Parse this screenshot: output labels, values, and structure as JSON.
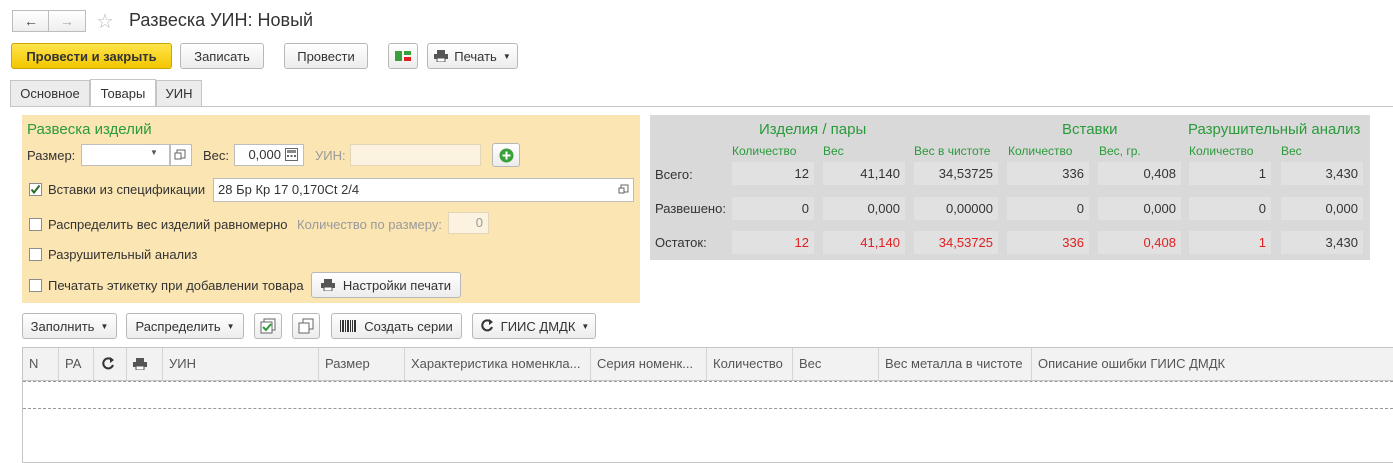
{
  "header": {
    "title": "Развеска УИН: Новый"
  },
  "toolbar": {
    "post_close": "Провести и закрыть",
    "save": "Записать",
    "post": "Провести",
    "print": "Печать"
  },
  "tabs": [
    {
      "label": "Основное"
    },
    {
      "label": "Товары"
    },
    {
      "label": "УИН"
    }
  ],
  "weighing": {
    "title": "Развеска изделий",
    "size_label": "Размер:",
    "size_value": "",
    "weight_label": "Вес:",
    "weight_value": "0,000",
    "uin_label": "УИН:",
    "uin_value": "",
    "spec_checkbox": "Вставки из спецификации",
    "spec_value": "28 Бр Кр 17 0,170Ct 2/4",
    "distribute_checkbox": "Распределить вес изделий равномерно",
    "qty_by_size_label": "Количество по размеру:",
    "qty_by_size_value": "0",
    "destructive_checkbox": "Разрушительный анализ",
    "print_label_checkbox": "Печатать этикетку при добавлении товара",
    "print_settings_button": "Настройки печати"
  },
  "summary": {
    "sections": [
      "Изделия / пары",
      "Вставки",
      "Разрушительный анализ"
    ],
    "columns": [
      "Количество",
      "Вес",
      "Вес в чистоте",
      "Количество",
      "Вес, гр.",
      "Количество",
      "Вес"
    ],
    "rows": [
      {
        "label": "Всего:",
        "values": [
          "12",
          "41,140",
          "34,53725",
          "336",
          "0,408",
          "1",
          "3,430"
        ]
      },
      {
        "label": "Развешено:",
        "values": [
          "0",
          "0,000",
          "0,00000",
          "0",
          "0,000",
          "0",
          "0,000"
        ]
      },
      {
        "label": "Остаток:",
        "values": [
          "12",
          "41,140",
          "34,53725",
          "336",
          "0,408",
          "1",
          "3,430"
        ]
      }
    ]
  },
  "table_toolbar": {
    "fill": "Заполнить",
    "distribute": "Распределить",
    "create_series": "Создать серии",
    "giis": "ГИИС ДМДК"
  },
  "table": {
    "columns": [
      "N",
      "РА",
      "",
      "",
      "УИН",
      "Размер",
      "Характеристика номенкла...",
      "Серия номенк...",
      "Количество",
      "Вес",
      "Вес металла в чистоте",
      "Описание ошибки ГИИС ДМДК"
    ]
  },
  "colors": {
    "accent_yellow": "#f2c600",
    "green": "#2a9a3a",
    "red": "#e02020",
    "panel_yellow": "#fbe5b3",
    "panel_grey": "#d9d9d9"
  }
}
